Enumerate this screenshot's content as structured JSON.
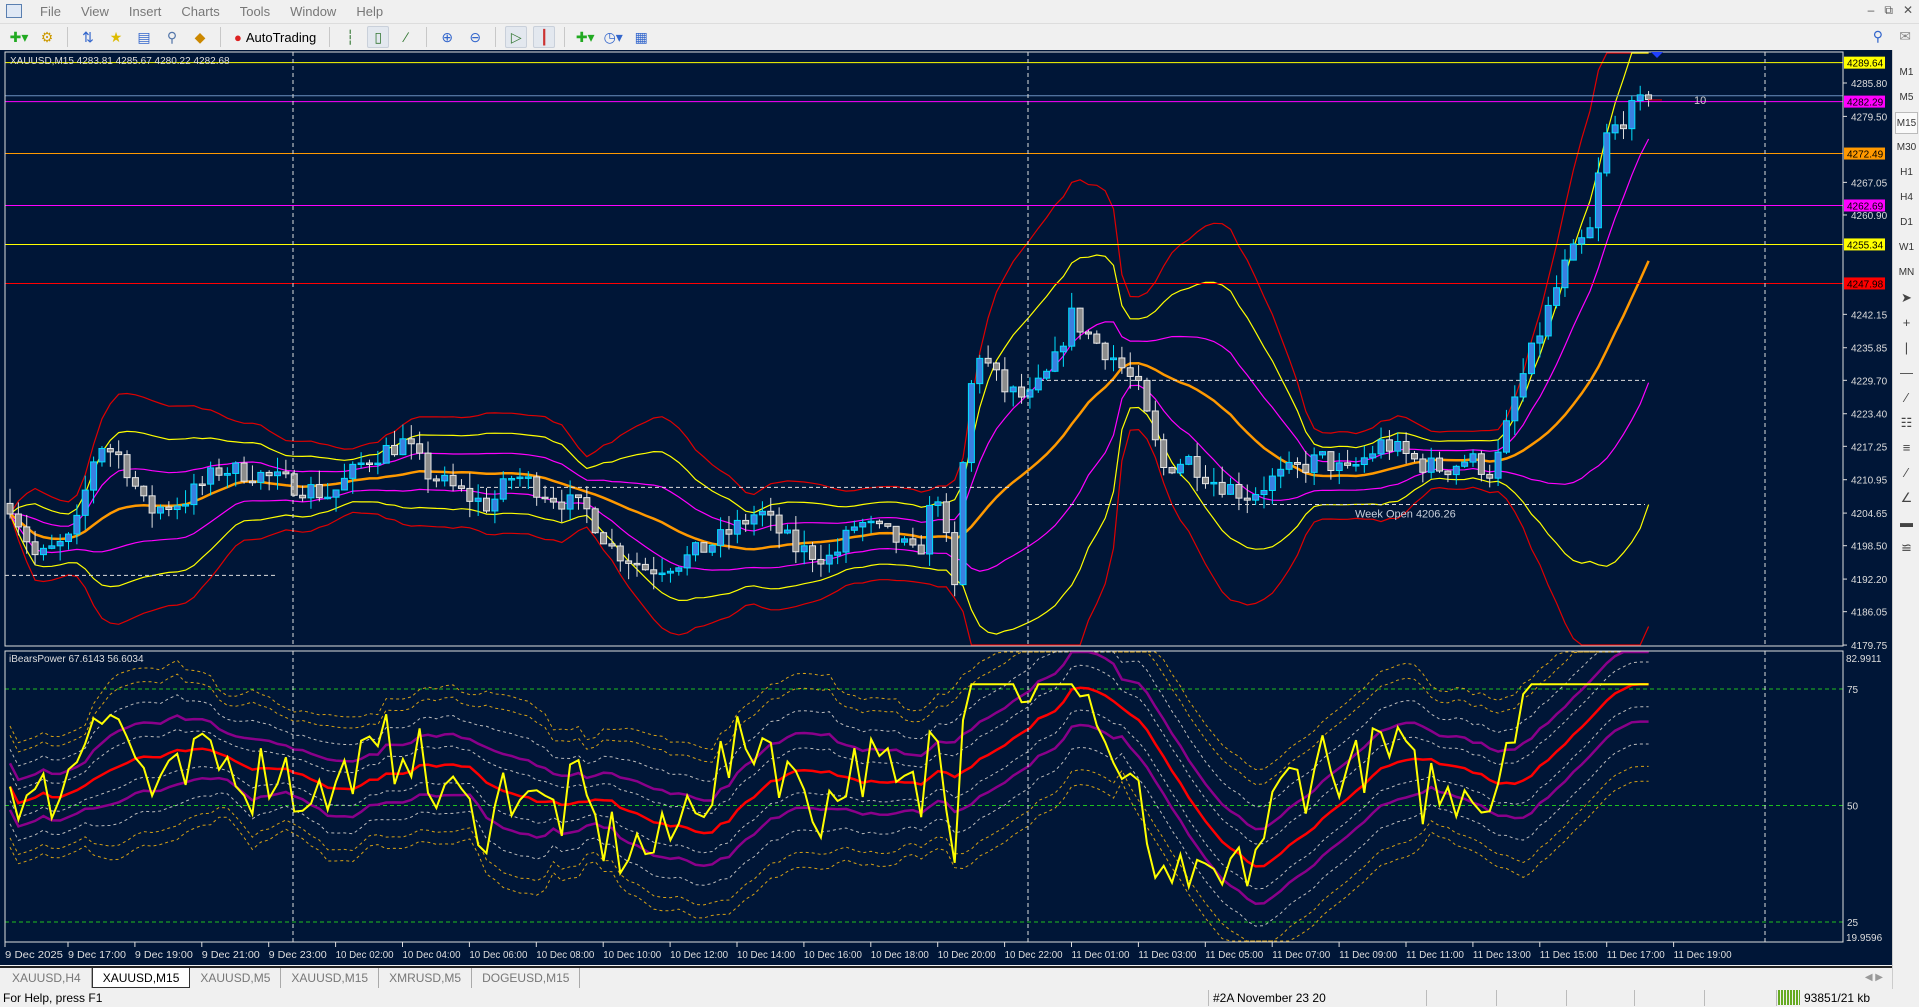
{
  "menu": [
    "File",
    "View",
    "Insert",
    "Charts",
    "Tools",
    "Window",
    "Help"
  ],
  "toolbar": {
    "autotrading_label": "AutoTrading"
  },
  "chart": {
    "header": "XAUUSD,M15  4283.81 4285.67 4280.22 4282.68",
    "price_ticks": [
      "4285.80",
      "4279.50",
      "4267.05",
      "4260.90",
      "4242.15",
      "4235.85",
      "4229.70",
      "4223.40",
      "4217.25",
      "4210.95",
      "4204.65",
      "4198.50",
      "4192.20",
      "4186.05",
      "4179.75"
    ],
    "price_markers": [
      {
        "label": "4289.64",
        "color": "#ffff00"
      },
      {
        "label": "4282.29",
        "color": "#ff00ff"
      },
      {
        "label": "4272.49",
        "color": "#ff9900"
      },
      {
        "label": "4262.69",
        "color": "#ff00ff"
      },
      {
        "label": "4255.34",
        "color": "#ffff00"
      },
      {
        "label": "4247.98",
        "color": "#ff0000"
      }
    ],
    "week_open_label": "Week Open 4206.26",
    "count_label": "10",
    "bull_color": "#3a7fe0",
    "bear_color": "#8c8c8c",
    "background": "#001637"
  },
  "indicator": {
    "header": "iBearsPower  67.6143 56.6034",
    "max_label": "82.9911",
    "min_label": "19.9596",
    "levels": [
      "75",
      "50",
      "25"
    ]
  },
  "time_labels": [
    "9 Dec 2025",
    "9 Dec 17:00",
    "9 Dec 19:00",
    "9 Dec 21:00",
    "9 Dec 23:00",
    "10 Dec 02:00",
    "10 Dec 04:00",
    "10 Dec 06:00",
    "10 Dec 08:00",
    "10 Dec 10:00",
    "10 Dec 12:00",
    "10 Dec 14:00",
    "10 Dec 16:00",
    "10 Dec 18:00",
    "10 Dec 20:00",
    "10 Dec 22:00",
    "11 Dec 01:00",
    "11 Dec 03:00",
    "11 Dec 05:00",
    "11 Dec 07:00",
    "11 Dec 09:00",
    "11 Dec 11:00",
    "11 Dec 13:00",
    "11 Dec 15:00",
    "11 Dec 17:00",
    "11 Dec 19:00"
  ],
  "timeframes": [
    "M1",
    "M5",
    "M15",
    "M30",
    "H1",
    "H4",
    "D1",
    "W1",
    "MN"
  ],
  "active_timeframe": "M15",
  "tabs": [
    "XAUUSD,H4",
    "XAUUSD,M15",
    "XAUUSD,M5",
    "XAUUSD,M15",
    "XMRUSD,M5",
    "DOGEUSD,M15"
  ],
  "active_tab": 1,
  "status": {
    "help": "For Help, press F1",
    "profile": "#2A November 23 20",
    "traffic": "93851/21 kb"
  }
}
